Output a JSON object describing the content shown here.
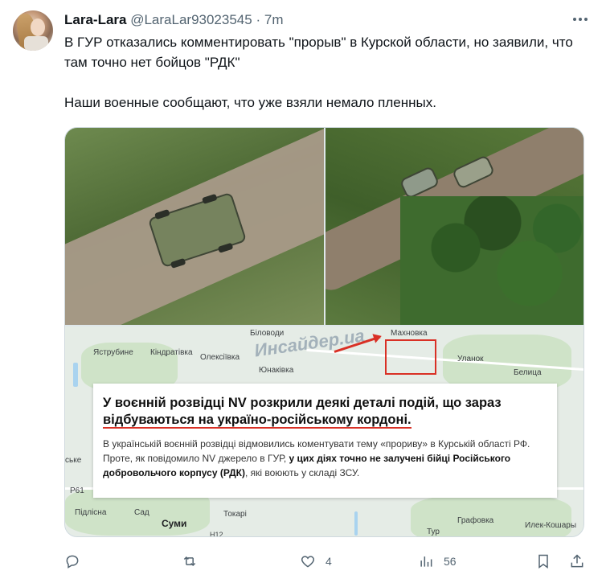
{
  "tweet": {
    "author_name": "Lara-Lara",
    "author_handle": "@LaraLar93023545",
    "separator": "·",
    "time": "7m",
    "text_line1": "В ГУР отказались комментировать \"прорыв\" в Курской области, но заявили, что там точно нет бойцов \"РДК\"",
    "text_line2": "Наши военные сообщают, что уже взяли немало пленных."
  },
  "media": {
    "watermark": "Инсайдер.ua",
    "map_labels": {
      "bilovody": "Біловоди",
      "makhnovka": "Махновка",
      "yastrubyne": "Яструбине",
      "kindratiyka": "Кіндратівка",
      "oleksiivka": "Олексіївка",
      "yunakivka": "Юнаківка",
      "ulanok": "Уланок",
      "belytsa": "Белица",
      "sko": "ське",
      "r61": "Р61",
      "pidlisna": "Підлісна",
      "sad": "Сад",
      "tokari": "Токарі",
      "sumy": "Суми",
      "h12": "Н12",
      "tur": "Тур",
      "grafovka": "Графовка",
      "ilek": "Илек-Кошары"
    },
    "news": {
      "title_part1": "У воєнній розвідці NV розкрили деякі деталі подій, що зараз ",
      "title_part2": "відбуваються на україно-російському кордоні.",
      "body_part1": "В українській воєнній розвідці відмовились коментувати тему «прориву» в Курській області РФ. Проте, як повідомило NV джерело в ГУР, ",
      "body_bold": "у цих діях точно не залучені бійці Російського добровольчого корпусу (РДК)",
      "body_part2": ", які воюють у складі ЗСУ."
    }
  },
  "actions": {
    "reply_count": "",
    "retweet_count": "",
    "like_count": "4",
    "views_count": "56"
  },
  "icons": {
    "more": "more-dots-icon",
    "reply": "reply-icon",
    "retweet": "retweet-icon",
    "like": "heart-icon",
    "views": "views-chart-icon",
    "bookmark": "bookmark-icon",
    "share": "share-icon"
  },
  "colors": {
    "text": "#0f1419",
    "secondary": "#536471",
    "border": "#cfd9de",
    "accent_red": "#d93025"
  }
}
